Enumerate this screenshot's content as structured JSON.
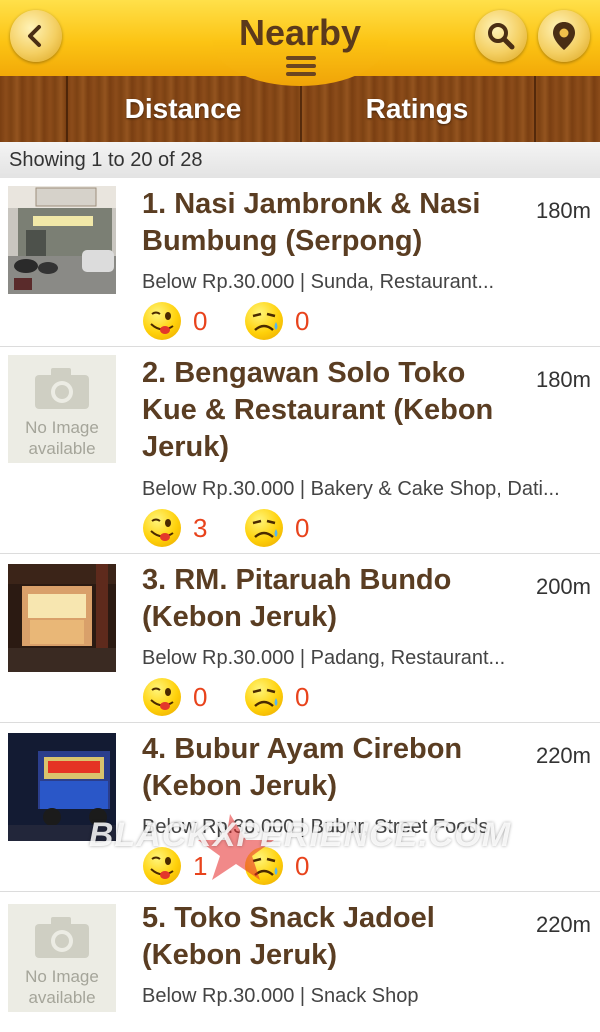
{
  "header": {
    "title": "Nearby",
    "back_icon": "chevron-left-icon",
    "menu_icon": "hamburger-icon",
    "search_icon": "search-icon",
    "location_icon": "map-pin-icon"
  },
  "tabs": {
    "distance": "Distance",
    "ratings": "Ratings"
  },
  "showing": "Showing 1 to 20 of 28",
  "colors": {
    "header_yellow": "#fcc414",
    "wood": "#7a3f12",
    "title_brown": "#5a3d22",
    "count_red": "#e8431c"
  },
  "items": [
    {
      "name": "1. Nasi Jambronk & Nasi Bumbung (Serpong)",
      "distance": "180m",
      "meta": "Below Rp.30.000 | Sunda, Restaurant...",
      "likes": "0",
      "dislikes": "0"
    },
    {
      "name": "2. Bengawan Solo Toko Kue & Restaurant (Kebon Jeruk)",
      "distance": "180m",
      "meta": "Below Rp.30.000 | Bakery & Cake Shop, Dati...",
      "likes": "3",
      "dislikes": "0"
    },
    {
      "name": "3. RM. Pitaruah Bundo (Kebon Jeruk)",
      "distance": "200m",
      "meta": "Below Rp.30.000 | Padang, Restaurant...",
      "likes": "0",
      "dislikes": "0"
    },
    {
      "name": "4. Bubur Ayam Cirebon (Kebon Jeruk)",
      "distance": "220m",
      "meta": "Below Rp.30.000 | Bubur, Street Foods",
      "likes": "1",
      "dislikes": "0"
    },
    {
      "name": "5. Toko Snack Jadoel (Kebon Jeruk)",
      "distance": "220m",
      "meta": "Below Rp.30.000 | Snack Shop",
      "likes": "",
      "dislikes": ""
    }
  ],
  "no_image": {
    "line1": "No Image",
    "line2": "available"
  },
  "watermark": "BLACKXPERIENCE.COM"
}
